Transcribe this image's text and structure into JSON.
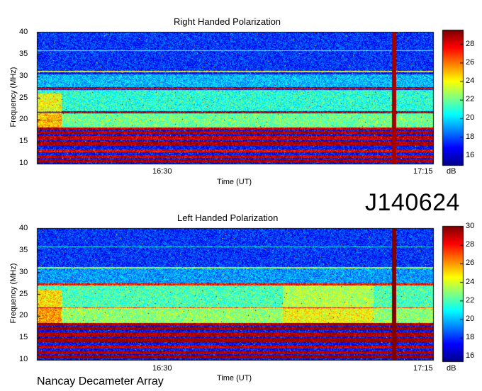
{
  "identifier": "J140624",
  "footer": "Nancay Decameter Array",
  "colorbar_unit": "dB",
  "colormap": [
    "#00008f",
    "#0000ff",
    "#0080ff",
    "#00ffff",
    "#80ff80",
    "#ffff00",
    "#ff8000",
    "#ff0000",
    "#800000"
  ],
  "chart_data": [
    {
      "type": "heatmap",
      "title": "Right Handed Polarization",
      "xlabel": "Time (UT)",
      "ylabel": "Frequency (MHz)",
      "x_ticks": [
        "16:30",
        "17:15"
      ],
      "y_ticks": [
        10,
        15,
        20,
        25,
        30,
        35,
        40
      ],
      "ylim": [
        10,
        40
      ],
      "colorbar": {
        "label": "dB",
        "ticks": [
          16,
          18,
          20,
          22,
          24,
          26,
          28
        ],
        "range": [
          15,
          29.5
        ]
      },
      "background_level": 17,
      "bands": [
        {
          "freq": [
            10.3,
            10.9
          ],
          "level": 29
        },
        {
          "freq": [
            11.3,
            11.9
          ],
          "level": 28.5
        },
        {
          "freq": [
            12.5,
            13.2
          ],
          "level": 28
        },
        {
          "freq": [
            14.0,
            15.0
          ],
          "level": 29
        },
        {
          "freq": [
            15.3,
            16.3
          ],
          "level": 28.5
        },
        {
          "freq": [
            16.7,
            17.4
          ],
          "level": 29
        },
        {
          "freq": [
            17.8,
            18.3
          ],
          "level": 28.5
        },
        {
          "freq": [
            19.8,
            20.0
          ],
          "level": 24
        },
        {
          "freq": [
            21.6,
            21.9
          ],
          "level": 28
        },
        {
          "freq": [
            27.0,
            27.4
          ],
          "level": 28
        },
        {
          "freq": [
            30.9,
            31.2
          ],
          "level": 24
        },
        {
          "freq": [
            35.8,
            36.0
          ],
          "level": 22
        }
      ],
      "broad_regions": [
        {
          "freq": [
            18.3,
            21.5
          ],
          "level": 22
        },
        {
          "freq": [
            22.0,
            26.8
          ],
          "level": 21
        },
        {
          "freq": [
            27.5,
            30.5
          ],
          "level": 19.5
        },
        {
          "freq": [
            31.2,
            40.0
          ],
          "level": 17.5
        }
      ],
      "vertical_lines": [
        {
          "time_fraction": 0.902,
          "level": 29
        }
      ]
    },
    {
      "type": "heatmap",
      "title": "Left Handed Polarization",
      "xlabel": "Time (UT)",
      "ylabel": "Frequency (MHz)",
      "x_ticks": [
        "16:30",
        "17:15"
      ],
      "y_ticks": [
        10,
        15,
        20,
        25,
        30,
        35,
        40
      ],
      "ylim": [
        10,
        40
      ],
      "colorbar": {
        "label": "dB",
        "ticks": [
          16,
          18,
          20,
          22,
          24,
          26,
          28,
          30
        ],
        "range": [
          15.5,
          30
        ]
      },
      "background_level": 17.5,
      "bands": [
        {
          "freq": [
            10.3,
            10.9
          ],
          "level": 30
        },
        {
          "freq": [
            11.3,
            11.9
          ],
          "level": 29.5
        },
        {
          "freq": [
            12.5,
            13.2
          ],
          "level": 29
        },
        {
          "freq": [
            14.0,
            15.0
          ],
          "level": 30
        },
        {
          "freq": [
            15.3,
            16.3
          ],
          "level": 29.5
        },
        {
          "freq": [
            16.7,
            17.4
          ],
          "level": 30
        },
        {
          "freq": [
            17.8,
            18.4
          ],
          "level": 29.5
        },
        {
          "freq": [
            21.8,
            22.0
          ],
          "level": 27
        },
        {
          "freq": [
            27.1,
            27.5
          ],
          "level": 28
        },
        {
          "freq": [
            31.0,
            31.2
          ],
          "level": 23
        },
        {
          "freq": [
            35.8,
            36.0
          ],
          "level": 21
        }
      ],
      "broad_regions": [
        {
          "freq": [
            18.4,
            21.8
          ],
          "level": 23
        },
        {
          "freq": [
            22.0,
            27.0
          ],
          "level": 22
        },
        {
          "freq": [
            27.5,
            31.0
          ],
          "level": 19.5
        },
        {
          "freq": [
            31.2,
            40.0
          ],
          "level": 18
        }
      ],
      "vertical_lines": [
        {
          "time_fraction": 0.902,
          "level": 30
        }
      ]
    }
  ]
}
